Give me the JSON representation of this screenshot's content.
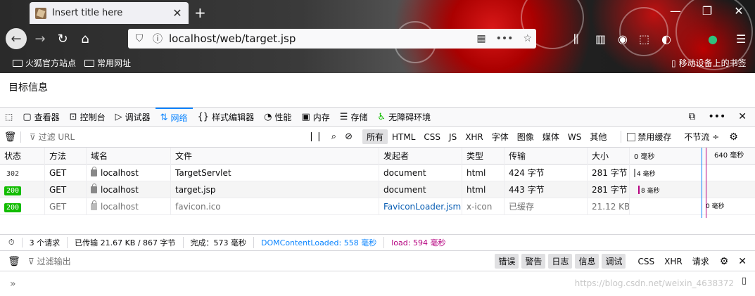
{
  "tab": {
    "title": "Insert title here",
    "close": "✕"
  },
  "newtab": "+",
  "window_controls": [
    "—",
    "❐",
    "✕"
  ],
  "nav": {
    "back": "←",
    "forward": "→",
    "reload": "↻",
    "home": "⌂"
  },
  "urlbar": {
    "url": "localhost/web/target.jsp"
  },
  "bookmarks": {
    "items": [
      "火狐官方站点",
      "常用网址"
    ],
    "mobile": "移动设备上的书签"
  },
  "page": {
    "title": "目标信息"
  },
  "devtools": {
    "tabs": [
      {
        "label": "查看器",
        "icon": "inspector-icon"
      },
      {
        "label": "控制台",
        "icon": "console-icon"
      },
      {
        "label": "调试器",
        "icon": "debugger-icon"
      },
      {
        "label": "网络",
        "icon": "network-icon"
      },
      {
        "label": "样式编辑器",
        "icon": "style-editor-icon"
      },
      {
        "label": "性能",
        "icon": "performance-icon"
      },
      {
        "label": "内存",
        "icon": "memory-icon"
      },
      {
        "label": "存储",
        "icon": "storage-icon"
      },
      {
        "label": "无障碍环境",
        "icon": "accessibility-icon"
      }
    ],
    "active_tab": "网络",
    "right_icons": [
      "⧉",
      "•••",
      "✕"
    ]
  },
  "network": {
    "filter_placeholder": "过滤 URL",
    "type_filters": [
      "所有",
      "HTML",
      "CSS",
      "JS",
      "XHR",
      "字体",
      "图像",
      "媒体",
      "WS",
      "其他"
    ],
    "active_type": "所有",
    "disable_cache": "禁用缓存",
    "throttle": "不节流 ÷",
    "columns": [
      "状态",
      "方法",
      "域名",
      "文件",
      "发起者",
      "类型",
      "传输",
      "大小",
      "0 毫秒",
      "640 毫秒"
    ],
    "rows": [
      {
        "status": "302",
        "method": "GET",
        "domain": "localhost",
        "file": "TargetServlet",
        "initiator": "document",
        "type": "html",
        "transferred": "424 字节",
        "size": "281 字节",
        "timing": "4 毫秒"
      },
      {
        "status": "200",
        "method": "GET",
        "domain": "localhost",
        "file": "target.jsp",
        "initiator": "document",
        "type": "html",
        "transferred": "443 字节",
        "size": "281 字节",
        "timing": "8 毫秒"
      },
      {
        "status": "200",
        "method": "GET",
        "domain": "localhost",
        "file": "favicon.ico",
        "initiator": "FaviconLoader.jsm:...",
        "type": "x-icon",
        "transferred": "已缓存",
        "size": "21.12 KB",
        "timing": "0 毫秒"
      }
    ],
    "summary": {
      "requests": "3 个请求",
      "transferred": "已传输 21.67 KB / 867 字节",
      "finish": "完成：573 毫秒",
      "dcl": "DOMContentLoaded: 558 毫秒",
      "load": "load: 594 毫秒"
    }
  },
  "console": {
    "filter_placeholder": "过滤输出",
    "levels_on": [
      "错误",
      "警告",
      "日志",
      "信息",
      "调试"
    ],
    "levels_off": [
      "CSS",
      "XHR",
      "请求"
    ],
    "prompt": "»"
  },
  "watermark": "https://blog.csdn.net/weixin_4638372",
  "colors": {
    "accent": "#0a84ff",
    "status_ok": "#12bc00",
    "load": "#b5007f"
  }
}
